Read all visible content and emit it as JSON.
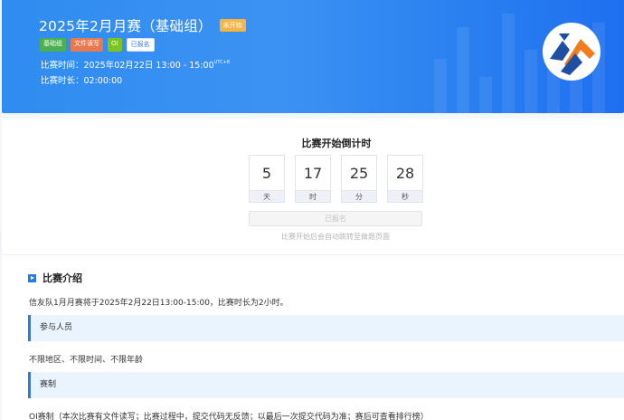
{
  "header": {
    "title": "2025年2月月赛（基础组）",
    "status": "未开始",
    "tags": [
      {
        "label": "基础组",
        "color": "#4caf50"
      },
      {
        "label": "文件读写",
        "color": "#e8794f"
      },
      {
        "label": "OI",
        "color": "#7cc520"
      },
      {
        "label": "已报名",
        "color": "#ffffff"
      }
    ],
    "time_label": "比赛时间：",
    "time_value": "2025年02月22日 13:00 - 15:00",
    "timezone": "UTC+8",
    "duration_label": "比赛时长：",
    "duration_value": "02:00:00",
    "accent": "#2f8cf0"
  },
  "countdown": {
    "title": "比赛开始倒计时",
    "items": [
      {
        "value": "5",
        "unit": "天"
      },
      {
        "value": "17",
        "unit": "时"
      },
      {
        "value": "25",
        "unit": "分"
      },
      {
        "value": "28",
        "unit": "秒"
      }
    ],
    "button_label": "已报名",
    "hint": "比赛开始后会自动跳转至做题页面"
  },
  "intro": {
    "title": "比赛介绍",
    "intro_text": "信友队1月月赛将于2025年2月22日13:00-15:00，比赛时长为2小时。",
    "participants_heading": "参与人员",
    "participants_text": "不限地区、不限时间、不限年龄",
    "rules_heading": "赛制",
    "rules_text": "OI赛制（本次比赛有文件读写；比赛过程中，提交代码无反馈；以最后一次提交代码为准；赛后可查看排行榜）"
  }
}
